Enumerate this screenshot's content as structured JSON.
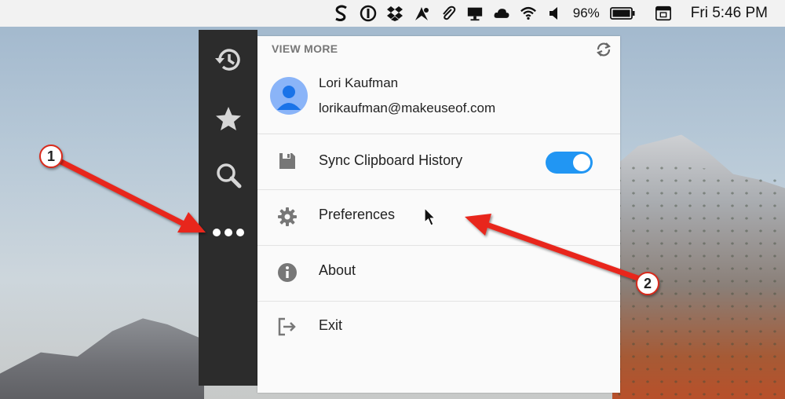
{
  "menubar": {
    "battery_percent": "96%",
    "clock": "Fri 5:46 PM",
    "icons": [
      "scrivener-s-icon",
      "1password-icon",
      "dropbox-icon",
      "alfred-icon",
      "paperclip-icon",
      "display-icon",
      "cloud-icon",
      "wifi-icon",
      "volume-icon",
      "battery-icon",
      "keyboard-icon"
    ]
  },
  "sidebar": {
    "items": [
      {
        "name": "history",
        "icon": "history-icon"
      },
      {
        "name": "favorites",
        "icon": "star-icon"
      },
      {
        "name": "search",
        "icon": "search-icon"
      },
      {
        "name": "more",
        "icon": "more-dots-icon"
      }
    ]
  },
  "panel": {
    "header": "VIEW MORE",
    "account": {
      "name": "Lori Kaufman",
      "email": "lorikaufman@makeuseof.com"
    },
    "menu": [
      {
        "label": "Sync Clipboard History",
        "icon": "floppy-disk-icon",
        "toggle_on": true
      },
      {
        "label": "Preferences",
        "icon": "gear-icon"
      },
      {
        "label": "About",
        "icon": "info-icon"
      },
      {
        "label": "Exit",
        "icon": "exit-icon"
      }
    ]
  },
  "annotations": {
    "badge1": "1",
    "badge2": "2",
    "arrow_color": "#e8271b"
  },
  "colors": {
    "sidebar_bg": "#2c2c2c",
    "toggle_on": "#2196f3",
    "avatar": "#8ab4f8"
  }
}
